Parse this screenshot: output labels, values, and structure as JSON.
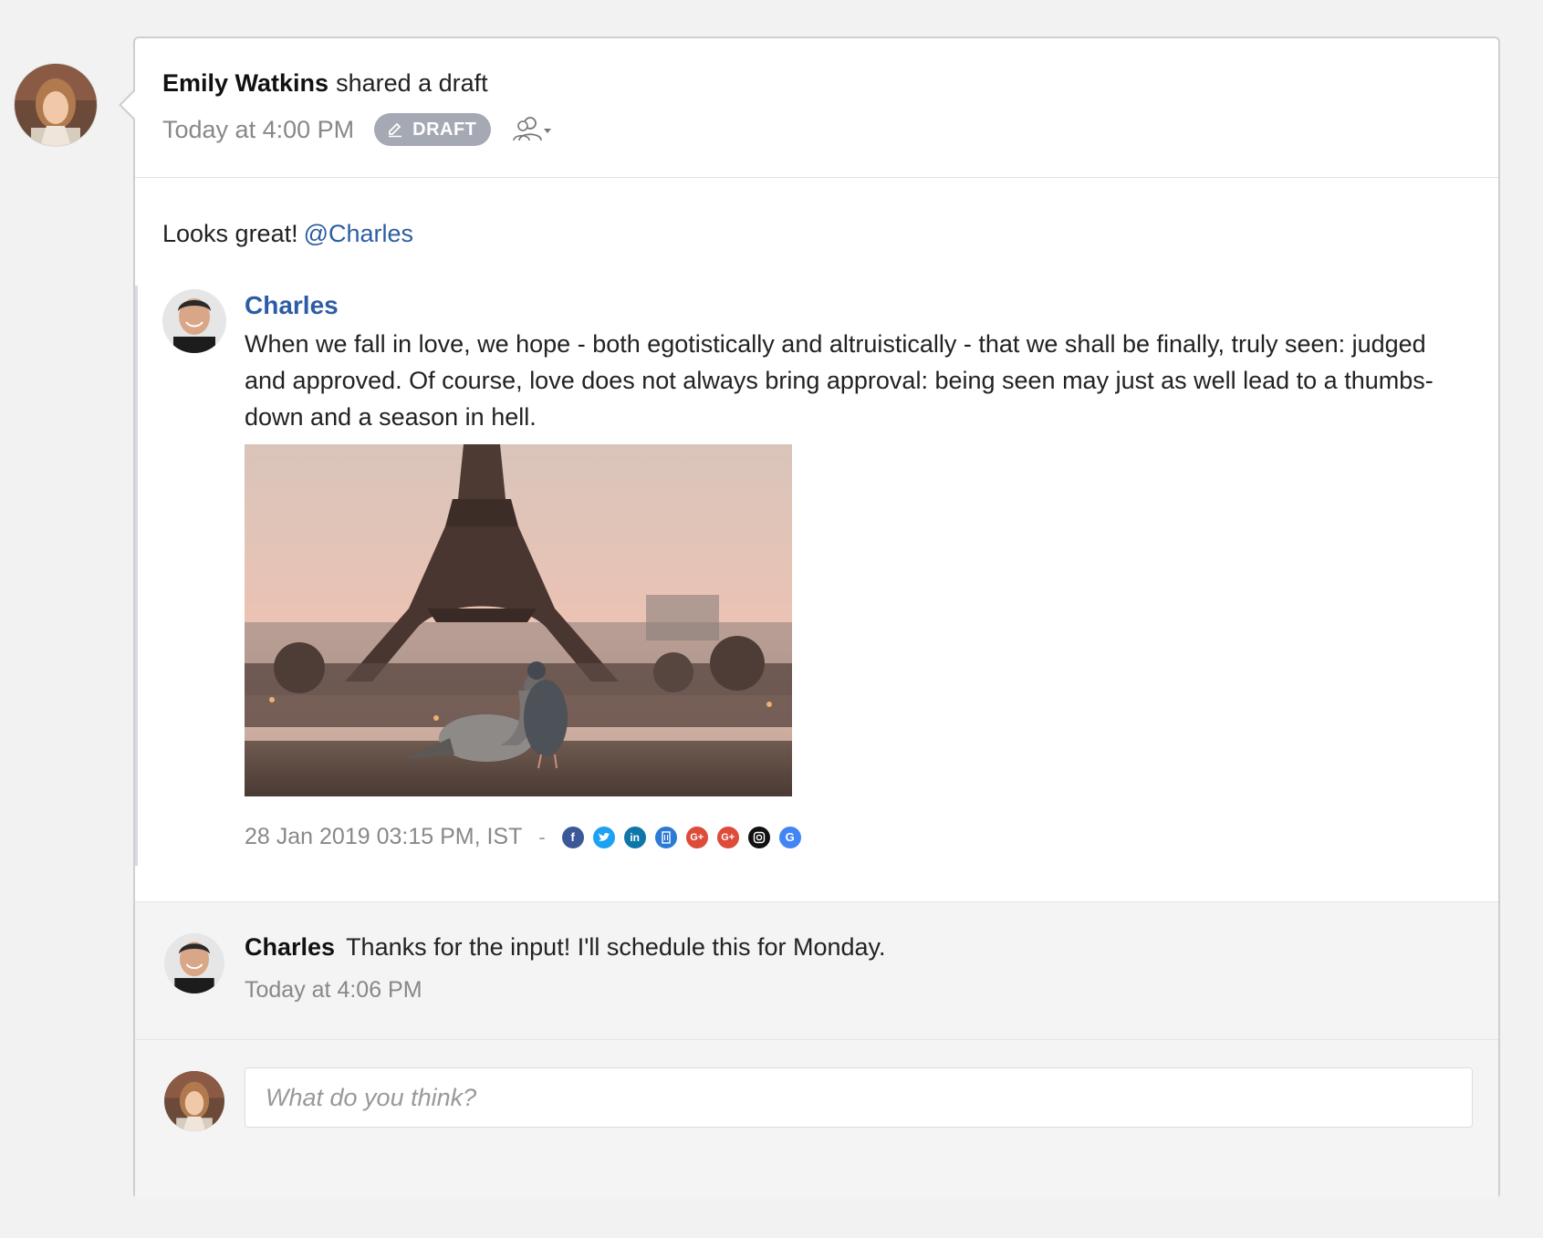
{
  "post": {
    "author": "Emily Watkins",
    "action": "shared a draft",
    "time": "Today at 4:00 PM",
    "badge": "DRAFT",
    "icons": {
      "badge": "pencil-icon",
      "share": "people-icon"
    }
  },
  "comment": {
    "text": "Looks great!",
    "mention": "@Charles"
  },
  "draft": {
    "author": "Charles",
    "text": "When we fall in love, we hope - both egotistically and altruistically - that we shall be finally, truly seen: judged and approved. Of course, love does not always bring approval: being seen may just as well lead to a thumbs-down and a season in hell.",
    "scheduled_time": "28 Jan 2019 03:15 PM, IST",
    "separator": "-",
    "networks": [
      {
        "name": "facebook-icon",
        "color": "#3b5998"
      },
      {
        "name": "twitter-icon",
        "color": "#1da1f2"
      },
      {
        "name": "linkedin-icon",
        "color": "#0e76a8"
      },
      {
        "name": "building-icon",
        "color": "#2d7ad6"
      },
      {
        "name": "google-plus-icon",
        "color": "#dd4b39"
      },
      {
        "name": "google-plus-icon",
        "color": "#dd4b39"
      },
      {
        "name": "instagram-icon",
        "color": "#111111"
      },
      {
        "name": "google-icon",
        "color": "#4285f4"
      }
    ]
  },
  "reply": {
    "author": "Charles",
    "text": "Thanks for the input! I'll schedule this for Monday.",
    "time": "Today at 4:06 PM"
  },
  "composer": {
    "placeholder": "What do you think?"
  }
}
